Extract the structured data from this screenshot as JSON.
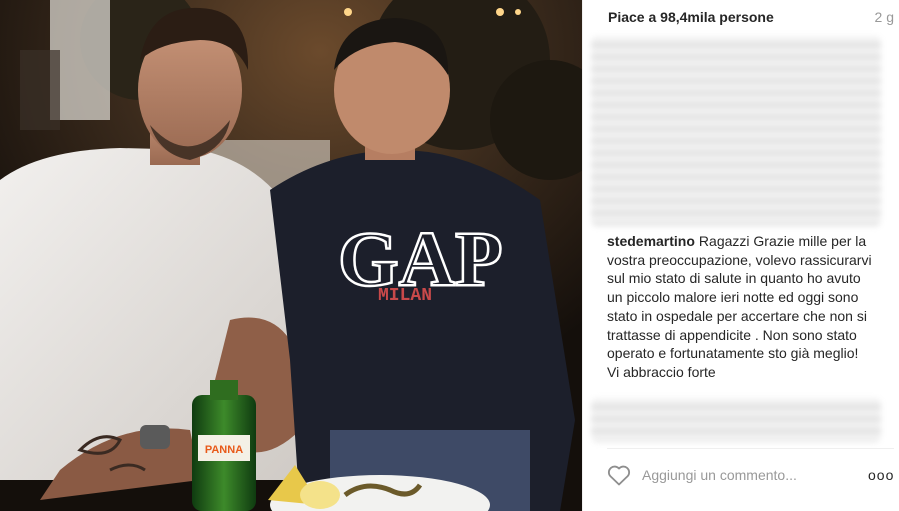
{
  "post": {
    "likes": "Piace a 98,4mila persone",
    "age": "2 g",
    "comment": {
      "username": "stedemartino",
      "text": "Ragazzi Grazie mille per la vostra preoccupazione, volevo rassicurarvi sul mio stato di salute in quanto ho avuto un piccolo malore ieri notte ed oggi sono stato in ospedale per accertare che non si trattasse di appendicite . Non sono stato operato e fortunatamente sto già meglio! Vi abbraccio forte"
    },
    "photo": {
      "shirt_brand": "GAP",
      "shirt_city": "MILAN",
      "bottle_label": "PANNA"
    },
    "add_comment": {
      "placeholder": "Aggiungi un commento...",
      "more_label": "ooo"
    },
    "icons": {
      "like": "heart-icon",
      "more": "more-options-icon"
    },
    "colors": {
      "text": "#262626",
      "muted": "#999999",
      "divider": "#efefef"
    }
  }
}
